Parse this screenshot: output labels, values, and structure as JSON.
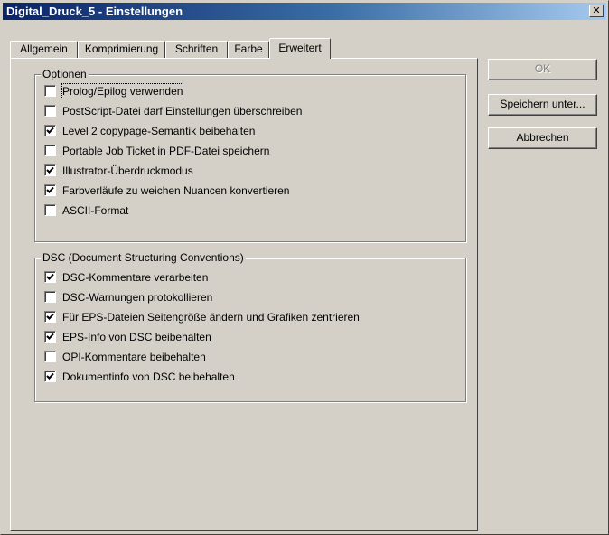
{
  "window": {
    "title": "Digital_Druck_5 - Einstellungen",
    "close_symbol": "✕"
  },
  "tabs": [
    {
      "label": "Allgemein",
      "active": false
    },
    {
      "label": "Komprimierung",
      "active": false
    },
    {
      "label": "Schriften",
      "active": false
    },
    {
      "label": "Farbe",
      "active": false
    },
    {
      "label": "Erweitert",
      "active": true
    }
  ],
  "optionen": {
    "label": "Optionen",
    "items": [
      {
        "label": "Prolog/Epilog verwenden",
        "checked": false
      },
      {
        "label": "PostScript-Datei darf Einstellungen überschreiben",
        "checked": false
      },
      {
        "label": "Level 2 copypage-Semantik beibehalten",
        "checked": true
      },
      {
        "label": "Portable Job Ticket in PDF-Datei speichern",
        "checked": false
      },
      {
        "label": "Illustrator-Überdruckmodus",
        "checked": true
      },
      {
        "label": "Farbverläufe zu weichen Nuancen konvertieren",
        "checked": true
      },
      {
        "label": "ASCII-Format",
        "checked": false
      }
    ]
  },
  "dsc": {
    "label": "DSC (Document Structuring Conventions)",
    "items": [
      {
        "label": "DSC-Kommentare verarbeiten",
        "checked": true
      },
      {
        "label": "DSC-Warnungen protokollieren",
        "checked": false
      },
      {
        "label": "Für EPS-Dateien Seitengröße ändern und Grafiken zentrieren",
        "checked": true
      },
      {
        "label": "EPS-Info von DSC beibehalten",
        "checked": true
      },
      {
        "label": "OPI-Kommentare beibehalten",
        "checked": false
      },
      {
        "label": "Dokumentinfo von DSC beibehalten",
        "checked": true
      }
    ]
  },
  "buttons": {
    "ok": "OK",
    "save_as": "Speichern unter...",
    "cancel": "Abbrechen"
  }
}
